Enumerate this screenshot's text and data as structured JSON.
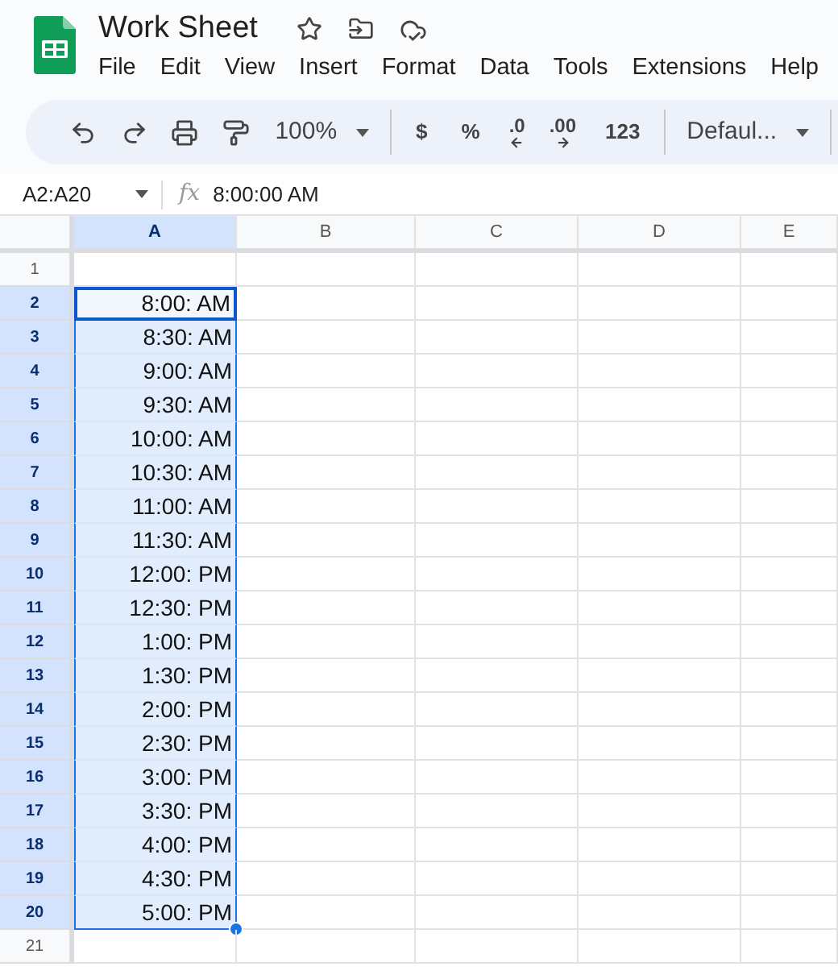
{
  "document": {
    "title": "Work Sheet",
    "starred": false
  },
  "menu": [
    "File",
    "Edit",
    "View",
    "Insert",
    "Format",
    "Data",
    "Tools",
    "Extensions",
    "Help"
  ],
  "toolbar": [
    {
      "kind": "undo"
    },
    {
      "kind": "redo"
    },
    {
      "kind": "print"
    },
    {
      "kind": "paint"
    },
    {
      "kind": "dropdown",
      "label": "100%"
    },
    {
      "kind": "divider"
    },
    {
      "kind": "text",
      "label": "$"
    },
    {
      "kind": "text",
      "label": "%"
    },
    {
      "kind": "decrease",
      "label": ".0"
    },
    {
      "kind": "increase",
      "label": ".00"
    },
    {
      "kind": "text",
      "label": "123"
    },
    {
      "kind": "divider"
    },
    {
      "kind": "dropdown",
      "label": "Defaul..."
    },
    {
      "kind": "divider"
    }
  ],
  "formula_bar": {
    "name_box": "A2:A20",
    "label": "fx",
    "value": "8:00:00 AM"
  },
  "columns": [
    {
      "label": "A",
      "selected": true
    },
    {
      "label": "B",
      "selected": false
    },
    {
      "label": "C",
      "selected": false
    },
    {
      "label": "D",
      "selected": false
    },
    {
      "label": "E",
      "selected": false
    }
  ],
  "rows": [
    {
      "number": "1",
      "selected": false,
      "active": false
    },
    {
      "number": "2",
      "selected": true,
      "active": true,
      "value": "8:00: AM"
    },
    {
      "number": "3",
      "selected": true,
      "active": false,
      "value": "8:30: AM"
    },
    {
      "number": "4",
      "selected": true,
      "active": false,
      "value": "9:00: AM"
    },
    {
      "number": "5",
      "selected": true,
      "active": false,
      "value": "9:30: AM"
    },
    {
      "number": "6",
      "selected": true,
      "active": false,
      "value": "10:00: AM"
    },
    {
      "number": "7",
      "selected": true,
      "active": false,
      "value": "10:30: AM"
    },
    {
      "number": "8",
      "selected": true,
      "active": false,
      "value": "11:00: AM"
    },
    {
      "number": "9",
      "selected": true,
      "active": false,
      "value": "11:30: AM"
    },
    {
      "number": "10",
      "selected": true,
      "active": false,
      "value": "12:00: PM"
    },
    {
      "number": "11",
      "selected": true,
      "active": false,
      "value": "12:30: PM"
    },
    {
      "number": "12",
      "selected": true,
      "active": false,
      "value": "1:00: PM"
    },
    {
      "number": "13",
      "selected": true,
      "active": false,
      "value": "1:30: PM"
    },
    {
      "number": "14",
      "selected": true,
      "active": false,
      "value": "2:00: PM"
    },
    {
      "number": "15",
      "selected": true,
      "active": false,
      "value": "2:30: PM"
    },
    {
      "number": "16",
      "selected": true,
      "active": false,
      "value": "3:00: PM"
    },
    {
      "number": "17",
      "selected": true,
      "active": false,
      "value": "3:30: PM"
    },
    {
      "number": "18",
      "selected": true,
      "active": false,
      "value": "4:00: PM"
    },
    {
      "number": "19",
      "selected": true,
      "active": false,
      "value": "4:30: PM"
    },
    {
      "number": "20",
      "selected": true,
      "active": false,
      "value": "5:00: PM"
    },
    {
      "number": "21",
      "selected": false,
      "active": false
    }
  ]
}
